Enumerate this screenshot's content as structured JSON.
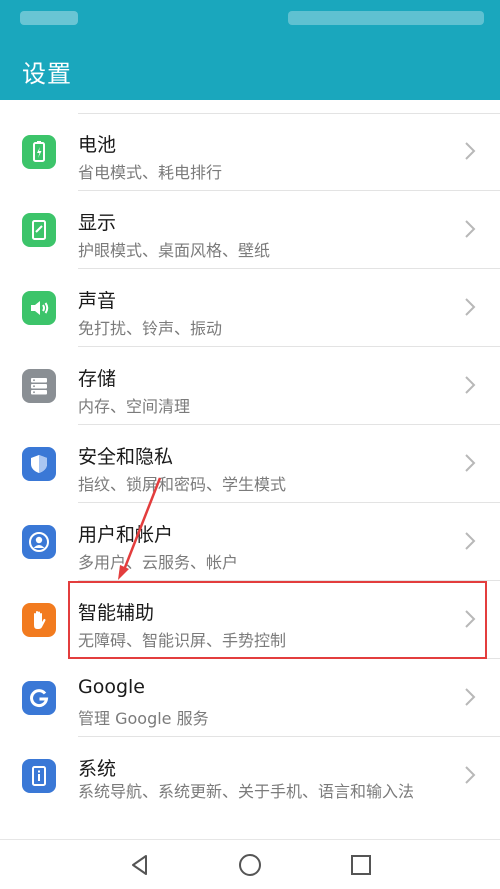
{
  "header": {
    "title": "设置"
  },
  "items": [
    {
      "title": "电池",
      "subtitle": "省电模式、耗电排行",
      "icon": "battery-icon",
      "color": "#3cc46a"
    },
    {
      "title": "显示",
      "subtitle": "护眼模式、桌面风格、壁纸",
      "icon": "display-icon",
      "color": "#3cc46a"
    },
    {
      "title": "声音",
      "subtitle": "免打扰、铃声、振动",
      "icon": "speaker-icon",
      "color": "#3cc46a"
    },
    {
      "title": "存储",
      "subtitle": "内存、空间清理",
      "icon": "storage-icon",
      "color": "#8a8f94"
    },
    {
      "title": "安全和隐私",
      "subtitle": "指纹、锁屏和密码、学生模式",
      "icon": "shield-icon",
      "color": "#3a78d6"
    },
    {
      "title": "用户和帐户",
      "subtitle": "多用户、云服务、帐户",
      "icon": "user-icon",
      "color": "#3a78d6"
    },
    {
      "title": "智能辅助",
      "subtitle": "无障碍、智能识屏、手势控制",
      "icon": "hand-icon",
      "color": "#f27b1f"
    },
    {
      "title": "Google",
      "subtitle": "管理 Google 服务",
      "icon": "google-icon",
      "color": "#3a78d6"
    },
    {
      "title": "系统",
      "subtitle": "系统导航、系统更新、关于手机、语言和输入法",
      "icon": "system-info-icon",
      "color": "#3a78d6"
    }
  ],
  "annotation": {
    "color": "#e33d3d"
  },
  "nav": {
    "back_icon": "back-triangle-icon",
    "home_icon": "home-circle-icon",
    "recent_icon": "recent-square-icon"
  },
  "theme": {
    "accent": "#1aa7bd"
  }
}
